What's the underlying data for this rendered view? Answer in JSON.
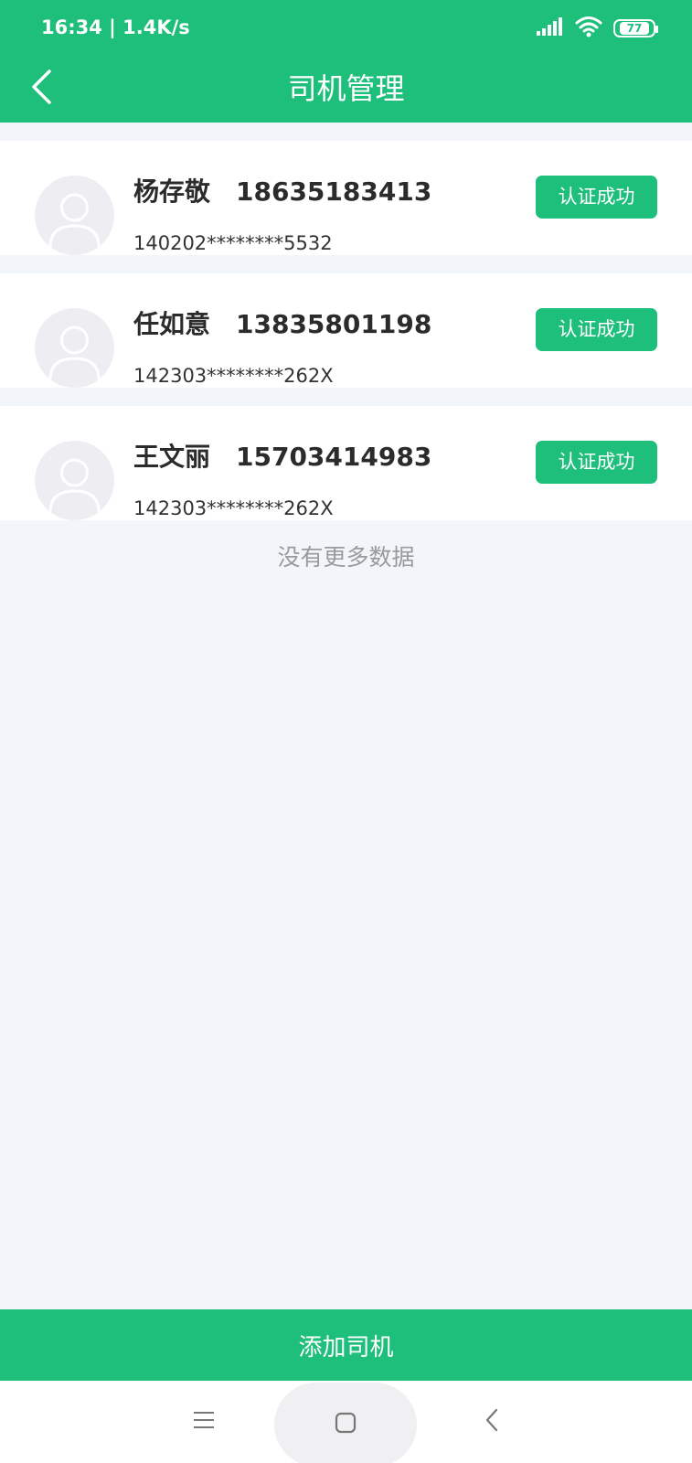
{
  "status_bar": {
    "time": "16:34 | 1.4K/s",
    "battery": "77",
    "icons": [
      "signal-icon",
      "wifi-icon",
      "battery-icon"
    ]
  },
  "header": {
    "title": "司机管理",
    "back_icon": "chevron-left-icon"
  },
  "drivers": [
    {
      "name": "杨存敬",
      "phone": "18635183413",
      "id_number": "140202********5532",
      "status": "认证成功"
    },
    {
      "name": "任如意",
      "phone": "13835801198",
      "id_number": "142303********262X",
      "status": "认证成功"
    },
    {
      "name": "王文丽",
      "phone": "15703414983",
      "id_number": "142303********262X",
      "status": "认证成功"
    }
  ],
  "list_footer": "没有更多数据",
  "add_button_label": "添加司机",
  "system_nav": [
    "menu-icon",
    "home-icon",
    "back-icon"
  ],
  "colors": {
    "accent": "#1ebe7b",
    "page_background": "#f2f6fb",
    "avatar_background": "#eeedf2",
    "muted_text": "#9a9a9a"
  }
}
